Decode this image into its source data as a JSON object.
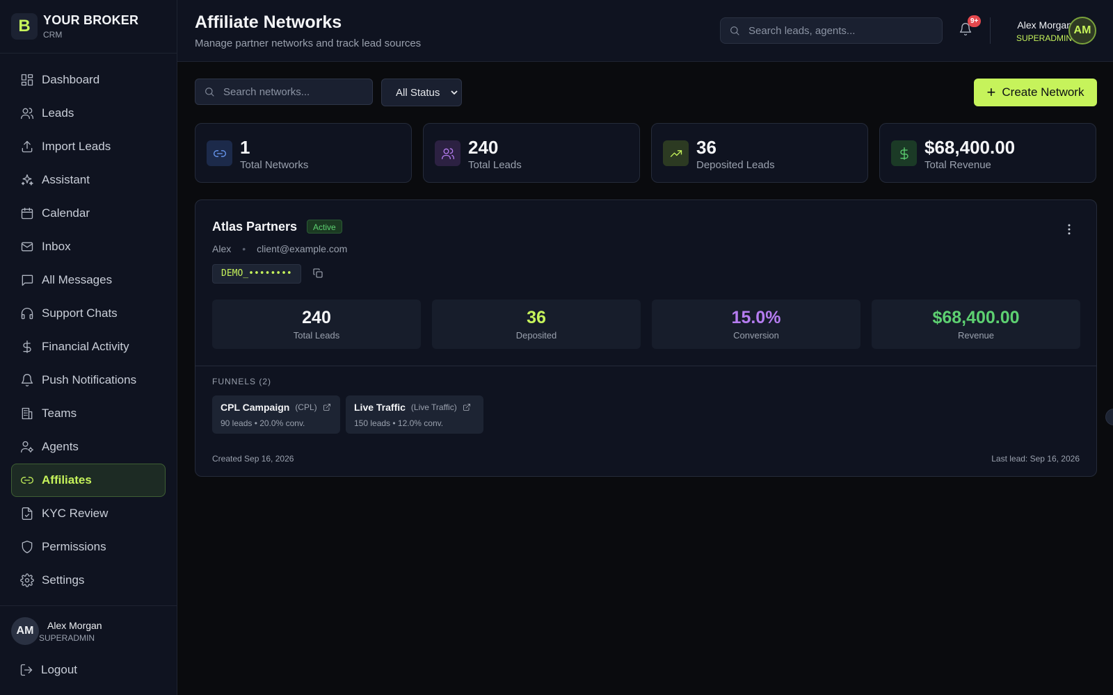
{
  "brand": {
    "logo_letter": "B",
    "name": "YOUR BROKER",
    "sub": "CRM",
    "accent": "#c6f35b"
  },
  "sidebar": {
    "items": [
      {
        "label": "Dashboard",
        "icon": "dashboard-icon"
      },
      {
        "label": "Leads",
        "icon": "users-icon"
      },
      {
        "label": "Import Leads",
        "icon": "upload-icon"
      },
      {
        "label": "Assistant",
        "icon": "sparkles-icon"
      },
      {
        "label": "Calendar",
        "icon": "calendar-icon"
      },
      {
        "label": "Inbox",
        "icon": "mail-icon"
      },
      {
        "label": "All Messages",
        "icon": "message-icon"
      },
      {
        "label": "Support Chats",
        "icon": "headphones-icon"
      },
      {
        "label": "Financial Activity",
        "icon": "dollar-icon"
      },
      {
        "label": "Push Notifications",
        "icon": "bell-icon"
      },
      {
        "label": "Teams",
        "icon": "building-icon"
      },
      {
        "label": "Agents",
        "icon": "user-cog-icon"
      },
      {
        "label": "Affiliates",
        "icon": "link-icon",
        "active": true
      },
      {
        "label": "KYC Review",
        "icon": "file-check-icon"
      },
      {
        "label": "Permissions",
        "icon": "shield-icon"
      },
      {
        "label": "Settings",
        "icon": "gear-icon"
      }
    ],
    "user": {
      "initials": "AM",
      "name": "Alex Morgan",
      "role": "SUPERADMIN"
    },
    "logout": "Logout"
  },
  "header": {
    "title": "Affiliate Networks",
    "subtitle": "Manage partner networks and track lead sources",
    "search_placeholder": "Search leads, agents...",
    "notif_badge": "9+",
    "user": {
      "initials": "AM",
      "name": "Alex Morgan",
      "role": "SUPERADMIN"
    }
  },
  "toolbar": {
    "search_placeholder": "Search networks...",
    "status_select": "All Status",
    "create_label": "Create Network"
  },
  "stats": [
    {
      "value": "1",
      "label": "Total Networks",
      "icon": "link-icon",
      "color": "#6b9bf5",
      "bg": "#1c2a4a"
    },
    {
      "value": "240",
      "label": "Total Leads",
      "icon": "users-icon",
      "color": "#b57cf0",
      "bg": "#2c2142"
    },
    {
      "value": "36",
      "label": "Deposited Leads",
      "icon": "trending-up-icon",
      "color": "#c6f35b",
      "bg": "#2c3a22"
    },
    {
      "value": "$68,400.00",
      "label": "Total Revenue",
      "icon": "dollar-icon",
      "color": "#5dd071",
      "bg": "#1b3a26"
    }
  ],
  "network": {
    "name": "Atlas Partners",
    "status": "Active",
    "contact_name": "Alex",
    "contact_email": "client@example.com",
    "code": "DEMO_••••••••",
    "metrics": [
      {
        "value": "240",
        "label": "Total Leads",
        "color": "#f4f5f7"
      },
      {
        "value": "36",
        "label": "Deposited",
        "color": "#c6f35b"
      },
      {
        "value": "15.0%",
        "label": "Conversion",
        "color": "#b57cf0"
      },
      {
        "value": "$68,400.00",
        "label": "Revenue",
        "color": "#5dd071"
      }
    ],
    "funnels_label": "FUNNELS (2)",
    "funnels": [
      {
        "name": "CPL Campaign",
        "type": "(CPL)",
        "stats": "90 leads • 20.0% conv."
      },
      {
        "name": "Live Traffic",
        "type": "(Live Traffic)",
        "stats": "150 leads • 12.0% conv."
      }
    ],
    "created": "Created Sep 16, 2026",
    "last_lead": "Last lead: Sep 16, 2026"
  }
}
